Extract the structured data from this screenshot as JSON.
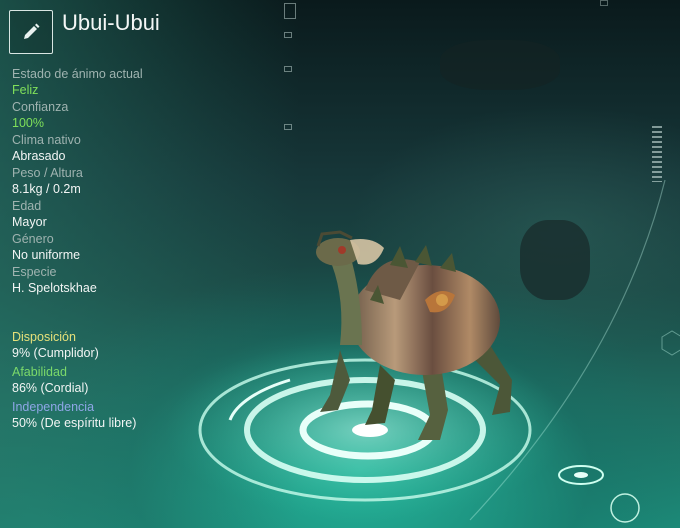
{
  "pal": {
    "name": "Ubui-Ubui"
  },
  "stats": [
    {
      "label": "Estado de ánimo actual",
      "value": "Feliz",
      "highlight": true
    },
    {
      "label": "Confianza",
      "value": "100%",
      "highlight": true
    },
    {
      "label": "Clima nativo",
      "value": "Abrasado",
      "highlight": false
    },
    {
      "label": "Peso / Altura",
      "value": "8.1kg / 0.2m",
      "highlight": false
    },
    {
      "label": "Edad",
      "value": "Mayor",
      "highlight": false
    },
    {
      "label": "Género",
      "value": "No uniforme",
      "highlight": false
    },
    {
      "label": "Especie",
      "value": "H. Spelotskhae",
      "highlight": false
    }
  ],
  "traits": [
    {
      "label": "Disposición",
      "value": "9% (Cumplidor)",
      "color": "#e6e07a"
    },
    {
      "label": "Afabilidad",
      "value": "86% (Cordial)",
      "color": "#7bd96a"
    },
    {
      "label": "Independencia",
      "value": "50% (De espíritu libre)",
      "color": "#8ea6e6"
    }
  ],
  "icons": {
    "edit": "pencil-icon"
  },
  "colors": {
    "accent_green": "#7fe05a",
    "platform": "#3fd9b8"
  }
}
